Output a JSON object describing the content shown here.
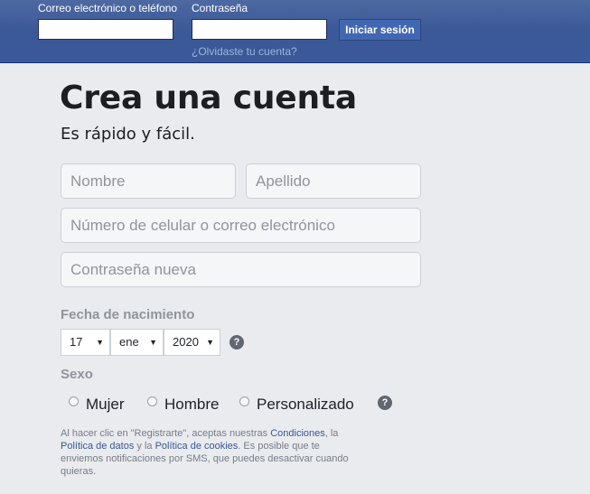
{
  "header": {
    "email_label": "Correo electrónico o teléfono",
    "password_label": "Contraseña",
    "login_button": "Iniciar sesión",
    "forgot_link": "¿Olvidaste tu cuenta?"
  },
  "signup": {
    "title": "Crea una cuenta",
    "subtitle": "Es rápido y fácil.",
    "first_name_placeholder": "Nombre",
    "last_name_placeholder": "Apellido",
    "contact_placeholder": "Número de celular o correo electrónico",
    "new_password_placeholder": "Contraseña nueva",
    "birthday_label": "Fecha de nacimiento",
    "birthday": {
      "day": "17",
      "month": "ene",
      "year": "2020"
    },
    "gender_label": "Sexo",
    "gender_options": [
      "Mujer",
      "Hombre",
      "Personalizado"
    ],
    "help_glyph": "?"
  },
  "terms": {
    "t1": "Al hacer clic en \"Registrarte\", aceptas nuestras ",
    "l1": "Condiciones",
    "t2": ", la ",
    "l2": "Política de datos",
    "t3": " y la ",
    "l3": "Política de cookies",
    "t4": ". Es posible que te enviemos notificaciones por SMS, que puedes desactivar cuando quieras."
  },
  "colors": {
    "header_bg": "#3b5998",
    "button_bg": "#4267b2",
    "page_bg": "#e9ebee",
    "link": "#385898"
  }
}
